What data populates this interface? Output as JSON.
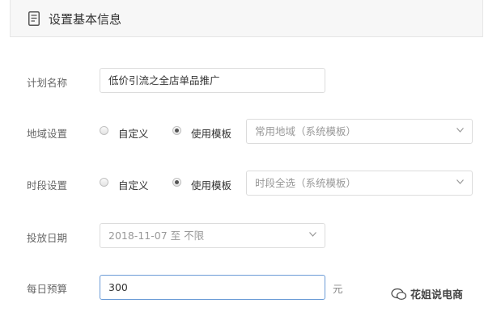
{
  "header": {
    "title": "设置基本信息"
  },
  "plan_name": {
    "label": "计划名称",
    "value": "低价引流之全店单品推广"
  },
  "region": {
    "label": "地域设置",
    "option_custom": "自定义",
    "option_template": "使用模板",
    "selected": "使用模板",
    "select_value": "常用地域（系统模板）"
  },
  "time_slot": {
    "label": "时段设置",
    "option_custom": "自定义",
    "option_template": "使用模板",
    "selected": "使用模板",
    "select_value": "时段全选（系统模板）"
  },
  "date": {
    "label": "投放日期",
    "value": "2018-11-07 至 不限"
  },
  "budget": {
    "label": "每日预算",
    "value": "300",
    "unit": "元"
  },
  "watermark": {
    "text": "花姐说电商"
  }
}
